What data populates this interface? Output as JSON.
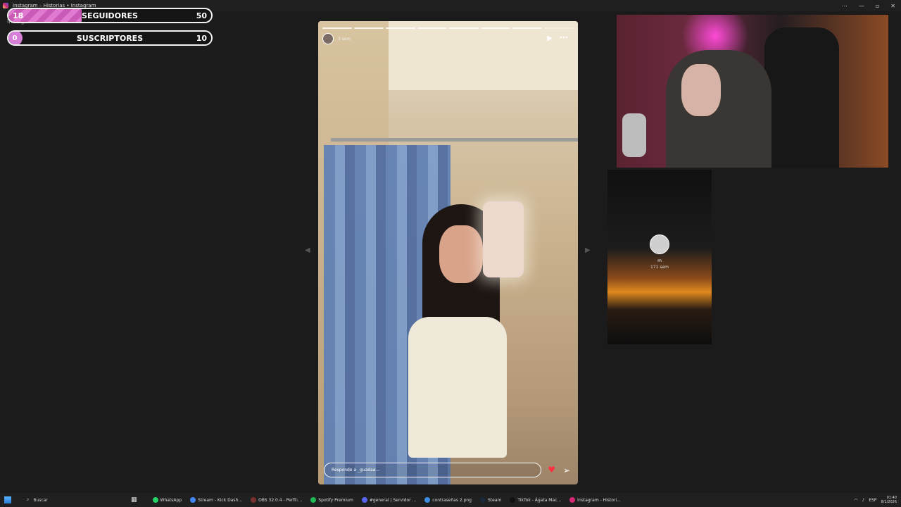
{
  "window": {
    "title": "Instagram – Historias • Instagram",
    "subtitle": "Instagram"
  },
  "counters": [
    {
      "left": "18",
      "label": "SEGUIDORES",
      "right": "50",
      "progress": 0.36
    },
    {
      "left": "0",
      "label": "SUSCRIPTORES",
      "right": "10",
      "progress": 0.0
    }
  ],
  "story": {
    "time": "3 sem",
    "reply_placeholder": "Responde a _guadaa...",
    "segments_total": 8,
    "segments_active": 7
  },
  "next_story": {
    "username": "m",
    "time": "171 sem"
  },
  "taskbar": {
    "search": "Buscar",
    "items": [
      {
        "label": "WhatsApp",
        "color": "#25d366"
      },
      {
        "label": "Stream - Kick Dash...",
        "color": "#4285f4"
      },
      {
        "label": "OBS 32.0.4 - Perfil:...",
        "color": "#7a3030"
      },
      {
        "label": "Spotify Premium",
        "color": "#1db954"
      },
      {
        "label": "#general | Servidor ...",
        "color": "#5865f2"
      },
      {
        "label": "contraseñas 2.png",
        "color": "#3b8de0"
      },
      {
        "label": "Steam",
        "color": "#1b2838"
      },
      {
        "label": "TikTok - Ágata Mac...",
        "color": "#111111"
      },
      {
        "label": "Instagram - Histori...",
        "color": "#d62976"
      }
    ],
    "lang": "ESP",
    "time": "01:40",
    "date": "8/1/2026"
  },
  "colors": {
    "accent": "#d67fd6",
    "heart": "#ff3040"
  }
}
